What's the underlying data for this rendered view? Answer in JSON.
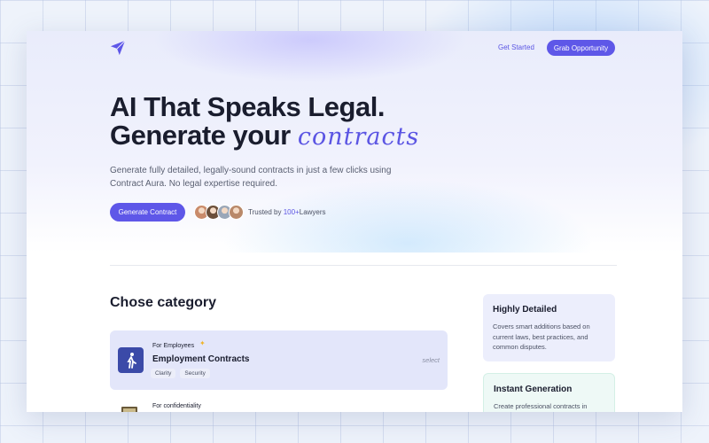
{
  "nav": {
    "get_started": "Get Started",
    "grab_opportunity": "Grab Opportunity"
  },
  "hero": {
    "headline_line1": "AI That Speaks Legal.",
    "headline_line2_prefix": "Generate your",
    "headline_line2_accent": "contracts",
    "subtext": "Generate fully detailed, legally-sound contracts in just a few clicks using Contract Aura. No legal expertise required.",
    "cta_label": "Generate Contract",
    "trusted_prefix": "Trusted by ",
    "trusted_count": "100+",
    "trusted_suffix": "Lawyers"
  },
  "avatars": [
    {
      "color": "#c98b6b"
    },
    {
      "color": "#6b4f3a"
    },
    {
      "color": "#9aa7b8"
    },
    {
      "color": "#b9896a"
    }
  ],
  "category": {
    "section_title": "Chose category",
    "items": [
      {
        "kicker": "For Employees",
        "title": "Employment Contracts",
        "tags": [
          "Clarity",
          "Security"
        ],
        "select_hint": "select",
        "icon": "walking-person-icon"
      },
      {
        "kicker": "For confidentiality",
        "icon": "certificate-icon"
      }
    ]
  },
  "features": [
    {
      "title": "Highly Detailed",
      "description": "Covers smart additions based on current laws, best practices, and common disputes."
    },
    {
      "title": "Instant Generation",
      "description": "Create professional contracts in"
    }
  ],
  "colors": {
    "accent": "#5e57e8",
    "heading": "#1a1d2e",
    "category_card": "#e3e6fa"
  }
}
